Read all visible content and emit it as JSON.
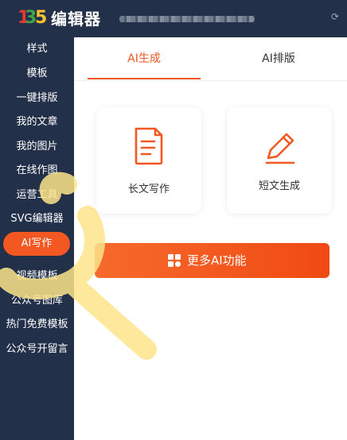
{
  "header": {
    "logo_text": "135",
    "app_title": "编辑器",
    "icons": {
      "refresh": "refresh-icon"
    }
  },
  "sidebar": {
    "items": [
      {
        "label": "样式"
      },
      {
        "label": "模板"
      },
      {
        "label": "一键排版"
      },
      {
        "label": "我的文章"
      },
      {
        "label": "我的图片"
      },
      {
        "label": "在线作图"
      },
      {
        "label": "运营工具"
      },
      {
        "label": "SVG编辑器"
      },
      {
        "label": "AI写作",
        "active": true
      },
      {
        "label": "视频模板"
      },
      {
        "label": "公众号图库"
      },
      {
        "label": "热门免费模板"
      },
      {
        "label": "公众号开留言"
      }
    ],
    "active_color": "#f35722",
    "background": "#23304a"
  },
  "tabs": [
    {
      "label": "AI生成",
      "active": true
    },
    {
      "label": "AI排版",
      "active": false
    }
  ],
  "cards": [
    {
      "label": "长文写作",
      "icon": "document-icon"
    },
    {
      "label": "短文生成",
      "icon": "pencil-icon"
    }
  ],
  "more_button": {
    "label": "更多AI功能",
    "icon": "grid-apps-icon"
  },
  "colors": {
    "accent": "#f35722",
    "highlighter": "#fde48a"
  }
}
